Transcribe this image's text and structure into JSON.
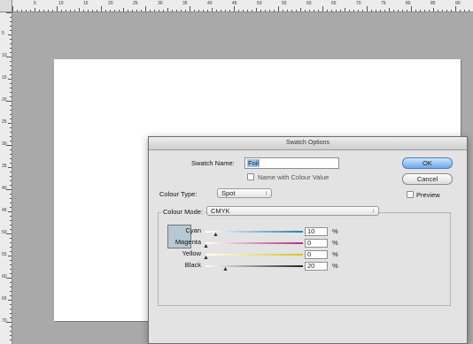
{
  "ruler": {
    "top_numbers": [
      "5",
      "10",
      "15",
      "20",
      "25",
      "30",
      "35",
      "40",
      "45",
      "50",
      "55",
      "60",
      "65",
      "70",
      "75",
      "80",
      "85",
      "90"
    ],
    "left_numbers": [
      "5",
      "10",
      "15",
      "20",
      "25",
      "30",
      "35",
      "40",
      "45",
      "50",
      "55",
      "60",
      "65",
      "70"
    ]
  },
  "dialog": {
    "title": "Swatch Options",
    "swatch_name_label": "Swatch Name:",
    "swatch_name_value": "Foil",
    "name_with_colour_value_label": "Name with Colour Value",
    "colour_type_label": "Colour Type:",
    "colour_type_value": "Spot",
    "colour_mode_label": "Colour Mode:",
    "colour_mode_value": "CMYK",
    "ok_label": "OK",
    "cancel_label": "Cancel",
    "preview_label": "Preview",
    "swatch_color": "#b7c8d3",
    "sliders": [
      {
        "label": "Cyan",
        "value": "10",
        "percent": 10,
        "unit": "%",
        "track_color": "#2a7dbb"
      },
      {
        "label": "Magenta",
        "value": "0",
        "percent": 0,
        "unit": "%",
        "track_color": "#b2307a"
      },
      {
        "label": "Yellow",
        "value": "0",
        "percent": 0,
        "unit": "%",
        "track_color": "#d7c11f"
      },
      {
        "label": "Black",
        "value": "20",
        "percent": 20,
        "unit": "%",
        "track_color": "#222222"
      }
    ]
  },
  "colors": {
    "pasteboard": "#a9a9a9",
    "artwork": "#98afbf",
    "ok_button": "#6ea8e6"
  }
}
